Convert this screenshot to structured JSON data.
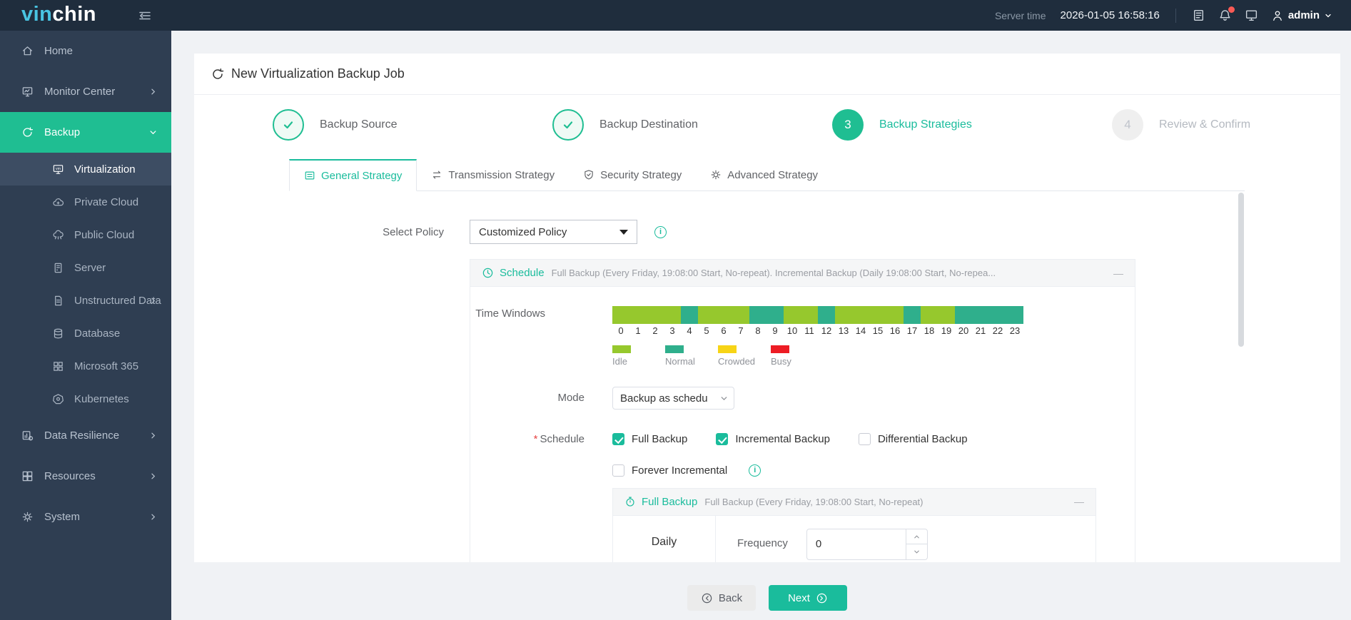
{
  "colors": {
    "accent": "#1ABC9C",
    "sidebar_active": "#1FBE92",
    "topbar_bg": "#1F2D3D",
    "sidebar_bg": "#2F3E52",
    "badge_red": "#FA5A55"
  },
  "topbar": {
    "logo_part1": "vin",
    "logo_part2": "chin",
    "server_time_label": "Server time",
    "server_time_value": "2026-01-05 16:58:16",
    "user_name": "admin"
  },
  "sidebar": {
    "items": [
      {
        "label": "Home"
      },
      {
        "label": "Monitor Center"
      },
      {
        "label": "Backup"
      },
      {
        "label": "Virtualization"
      },
      {
        "label": "Private Cloud"
      },
      {
        "label": "Public Cloud"
      },
      {
        "label": "Server"
      },
      {
        "label": "Unstructured Data"
      },
      {
        "label": "Database"
      },
      {
        "label": "Microsoft 365"
      },
      {
        "label": "Kubernetes"
      },
      {
        "label": "Data Resilience"
      },
      {
        "label": "Resources"
      },
      {
        "label": "System"
      }
    ]
  },
  "page": {
    "title": "New Virtualization Backup Job"
  },
  "stepper": {
    "steps": [
      {
        "label": "Backup Source",
        "state": "done"
      },
      {
        "label": "Backup Destination",
        "state": "done"
      },
      {
        "num": "3",
        "label": "Backup Strategies",
        "state": "current"
      },
      {
        "num": "4",
        "label": "Review & Confirm",
        "state": "pending"
      }
    ]
  },
  "tabs": [
    {
      "label": "General Strategy",
      "active": true
    },
    {
      "label": "Transmission Strategy",
      "active": false
    },
    {
      "label": "Security Strategy",
      "active": false
    },
    {
      "label": "Advanced Strategy",
      "active": false
    }
  ],
  "form": {
    "select_policy_label": "Select Policy",
    "select_policy_value": "Customized Policy",
    "mode_label": "Mode",
    "mode_value": "Backup as schedu",
    "schedule_label": "Schedule",
    "required_mark": "*",
    "schedule_options": [
      {
        "id": "full-backup",
        "label": "Full Backup",
        "checked": true
      },
      {
        "id": "incremental-backup",
        "label": "Incremental Backup",
        "checked": true
      },
      {
        "id": "differential-backup",
        "label": "Differential Backup",
        "checked": false
      },
      {
        "id": "forever-incremental",
        "label": "Forever Incremental",
        "checked": false
      }
    ]
  },
  "schedule_panel": {
    "title": "Schedule",
    "summary": "Full Backup (Every Friday, 19:08:00 Start, No-repeat). Incremental Backup (Daily 19:08:00 Start, No-repea...",
    "collapse_label": "—",
    "time_windows": {
      "label": "Time Windows",
      "hours": [
        "0",
        "1",
        "2",
        "3",
        "4",
        "5",
        "6",
        "7",
        "8",
        "9",
        "10",
        "11",
        "12",
        "13",
        "14",
        "15",
        "16",
        "17",
        "18",
        "19",
        "20",
        "21",
        "22",
        "23"
      ],
      "states": [
        "idle",
        "idle",
        "idle",
        "idle",
        "normal",
        "idle",
        "idle",
        "idle",
        "normal",
        "normal",
        "idle",
        "idle",
        "normal",
        "idle",
        "idle",
        "idle",
        "idle",
        "normal",
        "idle",
        "idle",
        "normal",
        "normal",
        "normal",
        "normal"
      ],
      "colors": {
        "idle": "#96C82D",
        "normal": "#2FAF8C",
        "crowded": "#F7D416",
        "busy": "#ED1C24"
      },
      "legend": [
        {
          "label": "Idle",
          "color": "#96C82D"
        },
        {
          "label": "Normal",
          "color": "#2FAF8C"
        },
        {
          "label": "Crowded",
          "color": "#F7D416"
        },
        {
          "label": "Busy",
          "color": "#ED1C24"
        }
      ]
    }
  },
  "full_backup_panel": {
    "title": "Full Backup",
    "summary": "Full Backup (Every Friday, 19:08:00 Start, No-repeat)",
    "collapse_label": "—",
    "period_value": "Daily",
    "frequency_label": "Frequency",
    "frequency_value": "0"
  },
  "icons": {
    "info_glyph": "i"
  },
  "footer": {
    "back_label": "Back",
    "next_label": "Next"
  }
}
